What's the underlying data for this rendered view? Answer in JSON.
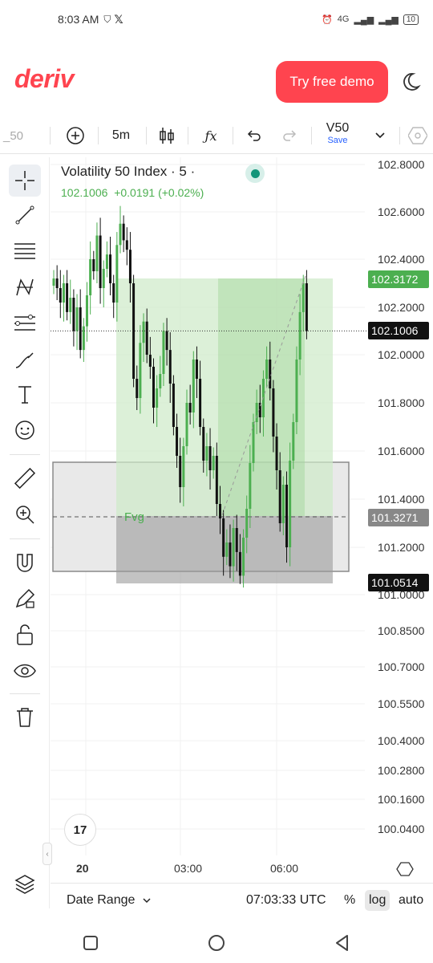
{
  "status_bar": {
    "time": "8:03 AM",
    "battery": "10",
    "network": "4G"
  },
  "header": {
    "logo": "deriv",
    "demo_button": "Try free demo"
  },
  "toolbar": {
    "left_partial": "_50",
    "interval": "5m",
    "symbol_code": "V50",
    "symbol_action": "Save"
  },
  "chart": {
    "title": "Volatility 50 Index · 5 ·",
    "last_price": "102.1006",
    "change": "+0.0191 (+0.02%)",
    "fvg_label": "Fvg",
    "x_axis": [
      "20",
      "03:00",
      "06:00"
    ]
  },
  "chart_data": {
    "type": "candlestick",
    "title": "Volatility 50 Index · 5 ·",
    "y_ticks": [
      "102.8000",
      "102.6000",
      "102.4000",
      "102.2000",
      "102.0000",
      "101.8000",
      "101.6000",
      "101.4000",
      "101.2000",
      "101.0000",
      "100.8500",
      "100.7000",
      "100.5500",
      "100.4000",
      "100.2800",
      "100.1600",
      "100.0400"
    ],
    "price_tags": [
      {
        "value": "102.3172",
        "color": "#4caf50"
      },
      {
        "value": "102.1006",
        "color": "#111111"
      },
      {
        "value": "101.3271",
        "color": "#888888"
      },
      {
        "value": "101.0514",
        "color": "#111111"
      }
    ],
    "x_labels": [
      "20",
      "03:00",
      "06:00"
    ],
    "scale": "log",
    "closes": [
      102.32,
      102.28,
      102.22,
      102.3,
      102.18,
      102.24,
      102.1,
      102.2,
      102.02,
      102.12,
      102.25,
      102.4,
      102.35,
      102.5,
      102.28,
      102.36,
      102.42,
      102.3,
      102.22,
      102.46,
      102.55,
      102.48,
      102.44,
      102.3,
      101.9,
      101.82,
      102.05,
      102.14,
      102.0,
      101.95,
      101.78,
      101.86,
      101.92,
      102.1,
      102.02,
      101.88,
      101.7,
      101.58,
      101.45,
      101.62,
      101.8,
      101.76,
      101.98,
      101.9,
      101.7,
      101.56,
      101.62,
      101.52,
      101.58,
      101.38,
      101.32,
      101.16,
      101.22,
      101.12,
      101.28,
      101.18,
      101.08,
      101.24,
      101.36,
      101.55,
      101.72,
      101.8,
      101.74,
      101.9,
      101.98,
      101.86,
      101.66,
      101.52,
      101.3,
      101.46,
      101.2,
      101.56,
      101.72,
      101.98,
      102.18,
      102.3,
      102.1
    ]
  },
  "bottom_bar": {
    "date_range": "Date Range",
    "clock": "07:03:33 UTC",
    "percent": "%",
    "log": "log",
    "auto": "auto"
  },
  "colors": {
    "accent": "#ff444f",
    "up": "#4caf50",
    "down": "#111111"
  }
}
